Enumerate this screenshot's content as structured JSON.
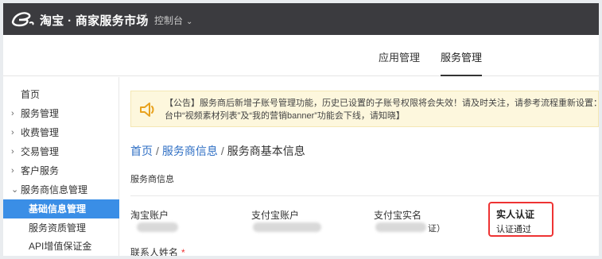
{
  "topbar": {
    "brand": "淘宝 · 商家服务市场",
    "separator": "/",
    "console": "控制台",
    "console_chevron": "⌄",
    "logo_icon": "taobao-e-logo"
  },
  "tabs": [
    {
      "label": "应用管理",
      "active": false
    },
    {
      "label": "服务管理",
      "active": true
    }
  ],
  "sidebar": {
    "items": [
      {
        "label": "首页",
        "arrow": "",
        "type": "top"
      },
      {
        "label": "服务管理",
        "arrow": "›",
        "type": "top"
      },
      {
        "label": "收费管理",
        "arrow": "›",
        "type": "top"
      },
      {
        "label": "交易管理",
        "arrow": "›",
        "type": "top"
      },
      {
        "label": "客户服务",
        "arrow": "›",
        "type": "top"
      },
      {
        "label": "服务商信息管理",
        "arrow": "⌄",
        "type": "top"
      },
      {
        "label": "基础信息管理",
        "arrow": "",
        "type": "active"
      },
      {
        "label": "服务资质管理",
        "arrow": "",
        "type": "sub"
      },
      {
        "label": "API增值保证金",
        "arrow": "",
        "type": "sub"
      }
    ]
  },
  "notice": {
    "icon": "speaker-icon",
    "line1": "【公告】服务商后新增子账号管理功能，历史已设置的子账号权限将会失效！请及时关注，请参考流程重新设置：https://fuwu.ta",
    "line2": "台中“视频素材列表”及“我的营销banner”功能会下线，请知晓】"
  },
  "breadcrumb": {
    "home": "首页",
    "sep": "/",
    "level2": "服务商信息",
    "current": "服务商基本信息"
  },
  "section": {
    "title": "服务商信息"
  },
  "fields": {
    "taobao_account": "淘宝账户",
    "alipay_account": "支付宝账户",
    "alipay_realname": "支付宝实名",
    "realname_suffix": "证）"
  },
  "verification": {
    "title": "实人认证",
    "status": "认证通过"
  },
  "contact": {
    "label": "联系人姓名",
    "required": "*"
  },
  "colors": {
    "topbar": "#3b3b3f",
    "active_sidebar": "#3a8ee6",
    "link": "#2f6fc4",
    "notice_bg": "#fdf7dd",
    "highlight_border": "#ee3333"
  }
}
